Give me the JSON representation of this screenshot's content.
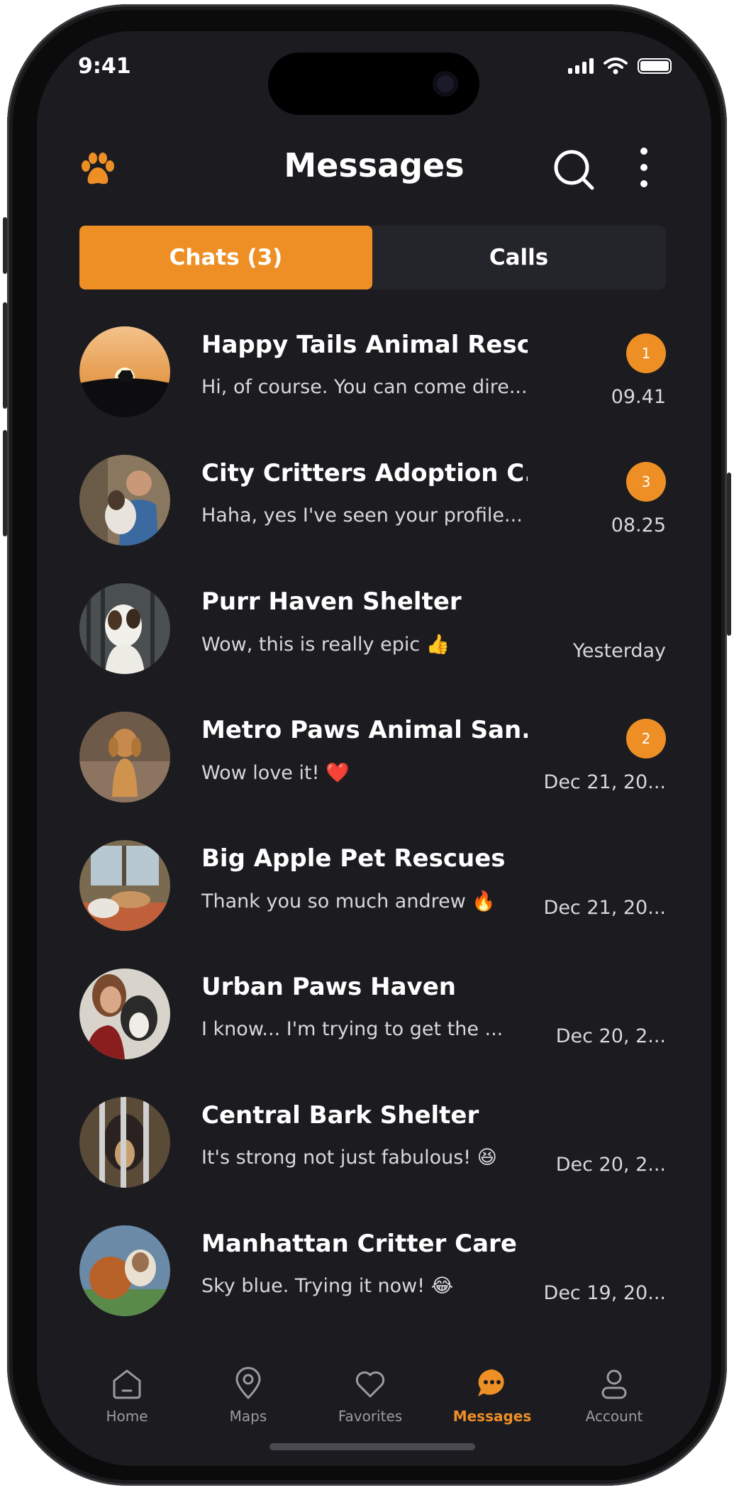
{
  "status_bar": {
    "time": "9:41"
  },
  "header": {
    "title": "Messages",
    "logo_icon": "paw-icon",
    "search_icon": "search-icon",
    "more_icon": "more-vertical-icon"
  },
  "tabs": [
    {
      "label": "Chats (3)",
      "active": true
    },
    {
      "label": "Calls",
      "active": false
    }
  ],
  "chats": [
    {
      "name": "Happy Tails Animal Resc...",
      "preview": "Hi, of course. You can come dire...",
      "time": "09.41",
      "unread": "1"
    },
    {
      "name": "City Critters Adoption C...",
      "preview": "Haha, yes I've seen your profile...",
      "time": "08.25",
      "unread": "3"
    },
    {
      "name": "Purr Haven Shelter",
      "preview": "Wow, this is really epic 👍",
      "time": "Yesterday",
      "unread": ""
    },
    {
      "name": "Metro Paws Animal San...",
      "preview": "Wow love it! ❤️",
      "time": "Dec 21, 20...",
      "unread": "2"
    },
    {
      "name": "Big Apple Pet Rescues",
      "preview": "Thank you so much andrew 🔥",
      "time": "Dec 21, 20...",
      "unread": ""
    },
    {
      "name": "Urban Paws Haven",
      "preview": "I know... I'm trying to get the ...",
      "time": "Dec 20, 2...",
      "unread": ""
    },
    {
      "name": "Central Bark Shelter",
      "preview": "It's strong not just fabulous! 😆",
      "time": "Dec 20, 2...",
      "unread": ""
    },
    {
      "name": "Manhattan Critter Care",
      "preview": "Sky blue. Trying it now! 😂",
      "time": "Dec 19, 20...",
      "unread": ""
    }
  ],
  "bottom_nav": [
    {
      "label": "Home",
      "icon": "home-icon",
      "active": false
    },
    {
      "label": "Maps",
      "icon": "location-pin-icon",
      "active": false
    },
    {
      "label": "Favorites",
      "icon": "heart-icon",
      "active": false
    },
    {
      "label": "Messages",
      "icon": "chat-bubble-icon",
      "active": true
    },
    {
      "label": "Account",
      "icon": "user-icon",
      "active": false
    }
  ],
  "colors": {
    "accent": "#ee8f25",
    "background": "#1c1c20",
    "tab_inactive": "#24252b"
  }
}
